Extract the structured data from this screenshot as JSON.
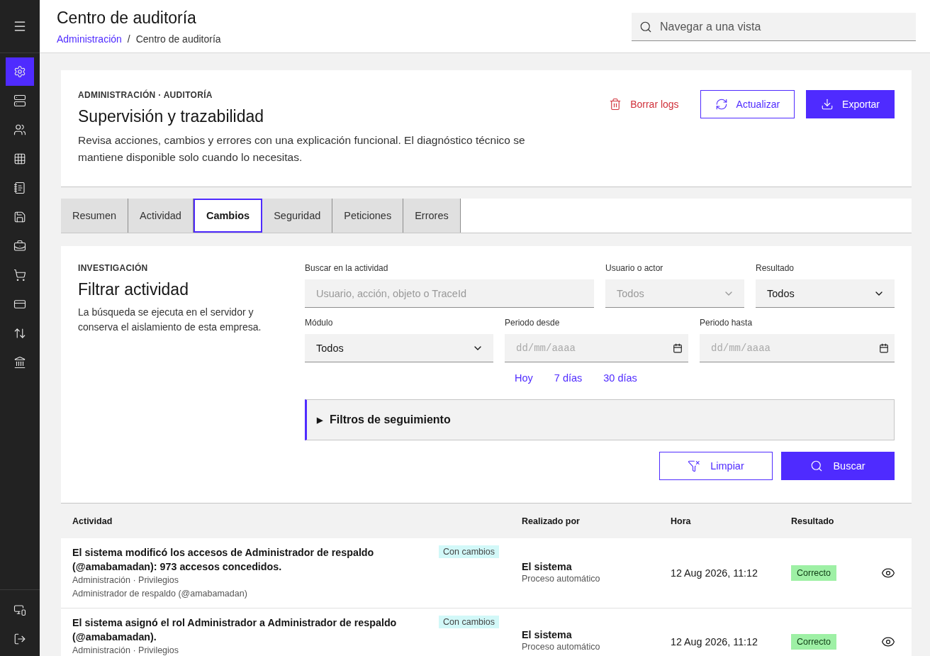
{
  "sidebar": {
    "items": [
      {
        "kind": "settings",
        "selected": true
      },
      {
        "kind": "server",
        "selected": false
      },
      {
        "kind": "users",
        "selected": false
      },
      {
        "kind": "grid",
        "selected": false
      },
      {
        "kind": "notebook",
        "selected": false
      },
      {
        "kind": "save",
        "selected": false
      },
      {
        "kind": "briefcase",
        "selected": false
      },
      {
        "kind": "cart",
        "selected": false
      },
      {
        "kind": "card",
        "selected": false
      },
      {
        "kind": "transfer",
        "selected": false
      },
      {
        "kind": "bank",
        "selected": false
      }
    ],
    "bottom_items": [
      {
        "kind": "monitor"
      },
      {
        "kind": "logout"
      }
    ]
  },
  "header": {
    "title": "Centro de auditoría",
    "breadcrumb": [
      "Administración",
      "Centro de auditoría"
    ],
    "breadcrumb_separator": "/",
    "search": {
      "placeholder": "Navegar a una vista"
    }
  },
  "intro": {
    "eyebrow": "ADMINISTRACIÓN · AUDITORÍA",
    "title": "Supervisión y trazabilidad",
    "description": "Revisa acciones, cambios y errores con una explicación funcional. El diagnóstico técnico se mantiene disponible solo cuando lo necesitas.",
    "actions": [
      {
        "kind": "danger",
        "label": "Borrar logs"
      },
      {
        "kind": "secondary",
        "label": "Actualizar"
      },
      {
        "kind": "primary",
        "label": "Exportar"
      }
    ]
  },
  "tabs": [
    {
      "label": "Resumen",
      "selected": false
    },
    {
      "label": "Actividad",
      "selected": false
    },
    {
      "label": "Cambios",
      "selected": true
    },
    {
      "label": "Seguridad",
      "selected": false
    },
    {
      "label": "Peticiones",
      "selected": false
    },
    {
      "label": "Errores",
      "selected": false
    }
  ],
  "filters": {
    "eyebrow": "INVESTIGACIÓN",
    "title": "Filtrar actividad",
    "description": "La búsqueda se ejecuta en el servidor y conserva el aislamiento de esta empresa.",
    "search": {
      "label": "Buscar en la actividad",
      "placeholder": "Usuario, acción, objeto o TraceId"
    },
    "user": {
      "label": "Usuario o actor",
      "placeholder": "Todos"
    },
    "result": {
      "label": "Resultado",
      "value": "Todos"
    },
    "module": {
      "label": "Módulo",
      "value": "Todos"
    },
    "from": {
      "label": "Periodo desde",
      "placeholder": "dd/mm/aaaa"
    },
    "to": {
      "label": "Periodo hasta",
      "placeholder": "dd/mm/aaaa"
    },
    "quick_ranges": [
      "Hoy",
      "7 días",
      "30 días"
    ],
    "accordion": {
      "marker": "▶",
      "label": "Filtros de seguimiento",
      "expanded": false
    },
    "buttons": [
      {
        "kind": "secondary",
        "label": "Limpiar"
      },
      {
        "kind": "primary",
        "label": "Buscar"
      }
    ]
  },
  "table": {
    "columns": [
      "Actividad",
      "Realizado por",
      "Hora",
      "Resultado"
    ],
    "rows": [
      {
        "activity": "El sistema modificó los accesos de Administrador de respaldo (@amabamadan): 973 accesos concedidos.",
        "tag": "Con cambios",
        "meta": [
          "Administración · Privilegios",
          "Administrador de respaldo (@amabamadan)"
        ],
        "actor": "El sistema",
        "actor_detail": "Proceso automático",
        "time": "12 Aug 2026, 11:12",
        "result": "Correcto"
      },
      {
        "activity": "El sistema asignó el rol Administrador a Administrador de respaldo (@amabamadan).",
        "tag": "Con cambios",
        "meta": [
          "Administración · Privilegios"
        ],
        "actor": "El sistema",
        "actor_detail": "Proceso automático",
        "time": "12 Aug 2026, 11:12",
        "result": "Correcto"
      }
    ]
  }
}
